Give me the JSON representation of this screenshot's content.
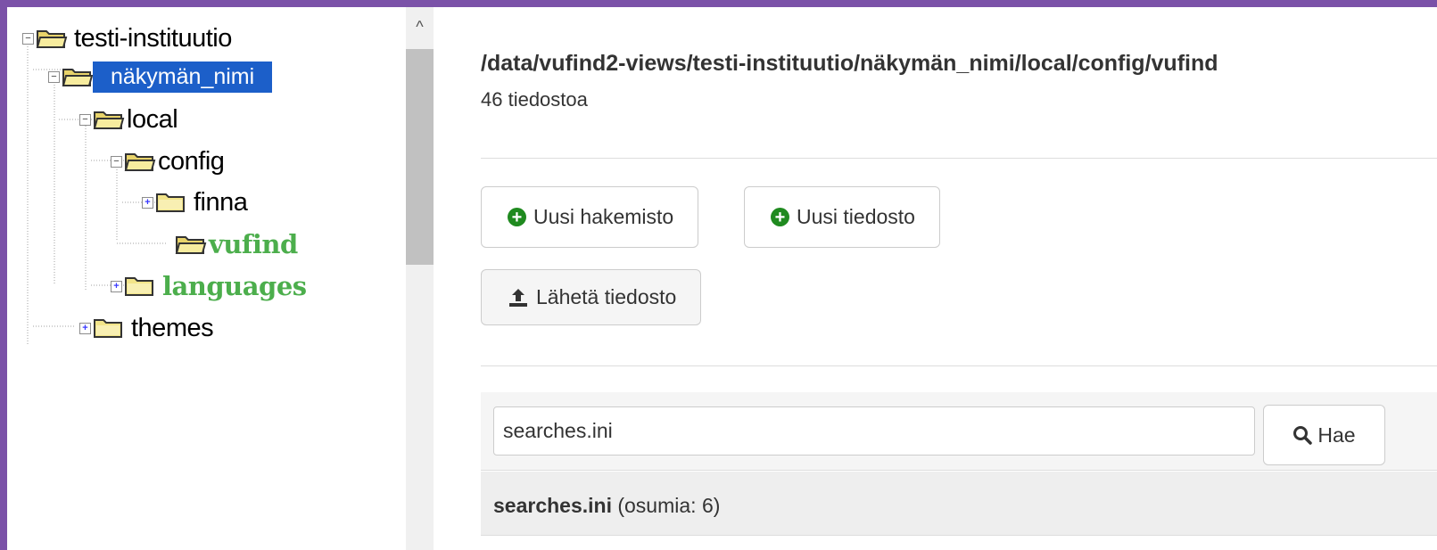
{
  "tree": {
    "root": {
      "label": "testi-instituutio",
      "toggle": "−"
    },
    "view": {
      "label": "näkymän_nimi",
      "toggle": "−",
      "selected": true
    },
    "local": {
      "label": "local",
      "toggle": "−"
    },
    "config": {
      "label": "config",
      "toggle": "−"
    },
    "finna": {
      "label": "finna",
      "toggle": "+"
    },
    "vufind": {
      "label": "vufind",
      "color": "#4cae4c"
    },
    "languages": {
      "label": "languages",
      "toggle": "+",
      "color": "#4cae4c"
    },
    "themes": {
      "label": "themes",
      "toggle": "+"
    }
  },
  "scrollbar": {
    "up_arrow": "^"
  },
  "main": {
    "path": "/data/vufind2-views/testi-instituutio/näkymän_nimi/local/config/vufind",
    "count": "46 tiedostoa",
    "buttons": {
      "new_dir": "Uusi hakemisto",
      "new_file": "Uusi tiedosto",
      "upload": "Lähetä tiedosto"
    },
    "search": {
      "value": "searches.ini",
      "button": "Hae"
    },
    "result": {
      "filename": "searches.ini",
      "hits": "(osumia: 6)"
    }
  },
  "colors": {
    "selection": "#1c5fc9",
    "green_label": "#4cae4c",
    "frame": "#7b52a8"
  }
}
